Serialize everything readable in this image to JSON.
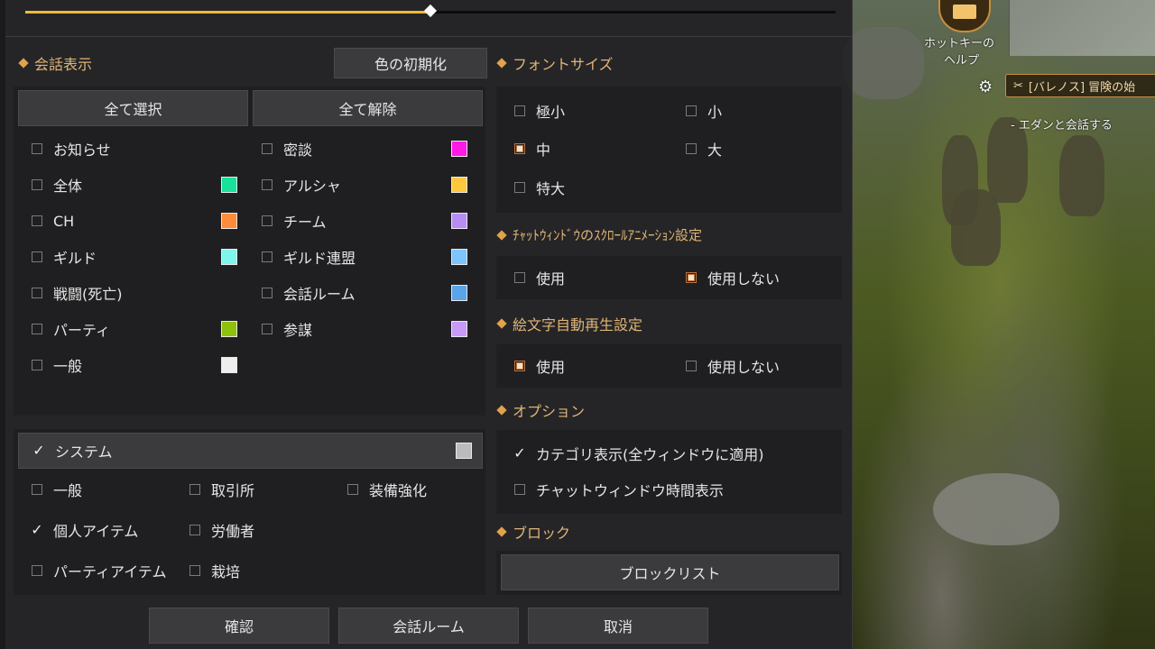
{
  "slider": {
    "value_fraction": 0.5
  },
  "chat_display": {
    "title": "会話表示",
    "reset_color_button": "色の初期化",
    "select_all": "全て選択",
    "deselect_all": "全て解除",
    "left_col": [
      {
        "label": "お知らせ",
        "state": "off",
        "color": null
      },
      {
        "label": "全体",
        "state": "off",
        "color": "#16e29a"
      },
      {
        "label": "CH",
        "state": "off",
        "color": "#ff8c3a"
      },
      {
        "label": "ギルド",
        "state": "off",
        "color": "#7ff5ee"
      },
      {
        "label": "戦闘(死亡)",
        "state": "off",
        "color": null
      },
      {
        "label": "パーティ",
        "state": "off",
        "color": "#8ec00e"
      },
      {
        "label": "一般",
        "state": "off",
        "color": "#eeeeee"
      }
    ],
    "right_col": [
      {
        "label": "密談",
        "state": "off",
        "color": "#ff19e6"
      },
      {
        "label": "アルシャ",
        "state": "off",
        "color": "#ffc83c"
      },
      {
        "label": "チーム",
        "state": "off",
        "color": "#b88df1"
      },
      {
        "label": "ギルド連盟",
        "state": "off",
        "color": "#7ec4ff"
      },
      {
        "label": "会話ルーム",
        "state": "off",
        "color": "#5aa4e8"
      },
      {
        "label": "参謀",
        "state": "off",
        "color": "#c79af7"
      }
    ]
  },
  "system": {
    "label": "システム",
    "checked": true,
    "color": "#bbbbbb",
    "items": [
      {
        "label": "一般",
        "checked": false
      },
      {
        "label": "取引所",
        "checked": false
      },
      {
        "label": "装備強化",
        "checked": false
      },
      {
        "label": "個人アイテム",
        "checked": true
      },
      {
        "label": "労働者",
        "checked": false
      },
      {
        "label": "パーティアイテム",
        "checked": false
      },
      {
        "label": "栽培",
        "checked": false
      }
    ]
  },
  "font_size": {
    "title": "フォントサイズ",
    "options": [
      {
        "label": "極小",
        "selected": false
      },
      {
        "label": "小",
        "selected": false
      },
      {
        "label": "中",
        "selected": true
      },
      {
        "label": "大",
        "selected": false
      },
      {
        "label": "特大",
        "selected": false
      }
    ]
  },
  "scroll_anim": {
    "title": "ﾁｬｯﾄｳｨﾝﾄﾞｳのｽｸﾛｰﾙｱﾆﾒｰｼｮﾝ設定",
    "use": "使用",
    "no_use": "使用しない",
    "selected": "no_use"
  },
  "emoji_autoplay": {
    "title": "絵文字自動再生設定",
    "use": "使用",
    "no_use": "使用しない",
    "selected": "use"
  },
  "options": {
    "title": "オプション",
    "items": [
      {
        "label": "カテゴリ表示(全ウィンドウに適用)",
        "checked": true
      },
      {
        "label": "チャットウィンドウ時間表示",
        "checked": false
      }
    ]
  },
  "block": {
    "title": "ブロック",
    "list_button": "ブロックリスト"
  },
  "footer": {
    "confirm": "確認",
    "chat_room": "会話ルーム",
    "cancel": "取消"
  },
  "hud": {
    "hotkey_help": "ホットキーの\nヘルプ",
    "hotkey_line1": "ホットキーの",
    "hotkey_line2": "ヘルプ",
    "quest_title": "[バレノス] 冒険の始",
    "quest_sub": "- エダンと会話する"
  },
  "colors": {
    "accent": "#e0b576",
    "slider_fill": "#f0b93a"
  }
}
